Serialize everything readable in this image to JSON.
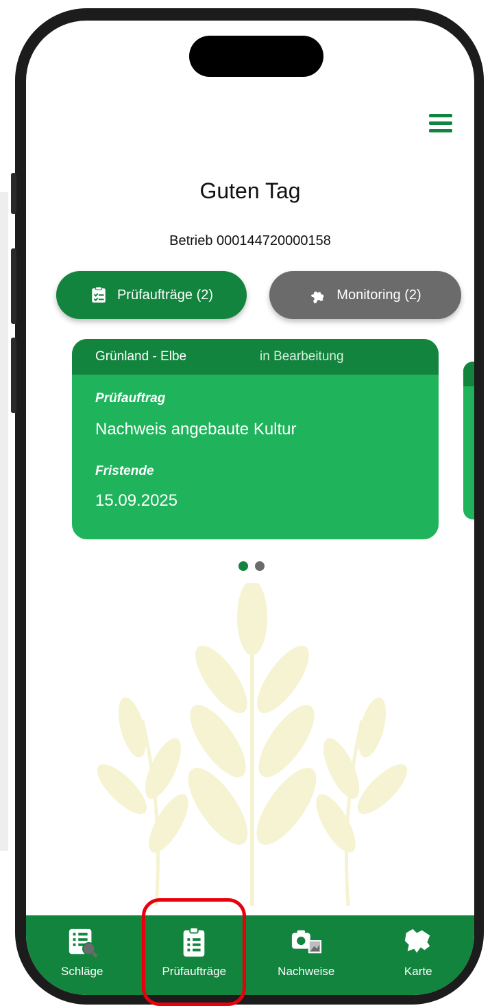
{
  "header": {
    "greeting": "Guten Tag",
    "business": "Betrieb 000144720000158"
  },
  "tabs": [
    {
      "label": "Prüfaufträge (2)",
      "icon": "clipboard-check-icon",
      "active": true
    },
    {
      "label": "Monitoring (2)",
      "icon": "puzzle-icon",
      "active": false
    }
  ],
  "card": {
    "location": "Grünland - Elbe",
    "status": "in Bearbeitung",
    "type_label": "Prüfauftrag",
    "type_value": "Nachweis angebaute Kultur",
    "deadline_label": "Fristende",
    "deadline_value": "15.09.2025"
  },
  "carousel": {
    "pages": 2,
    "current": 1
  },
  "nav": [
    {
      "label": "Schläge",
      "icon": "field-list-search-icon"
    },
    {
      "label": "Prüfaufträge",
      "icon": "clipboard-list-icon"
    },
    {
      "label": "Nachweise",
      "icon": "camera-gallery-icon"
    },
    {
      "label": "Karte",
      "icon": "map-icon"
    }
  ],
  "colors": {
    "primary": "#12843e",
    "card": "#1fb35c",
    "secondary": "#6b6b6b",
    "highlight": "#e8000d",
    "wheat": "#f6f3d2"
  }
}
